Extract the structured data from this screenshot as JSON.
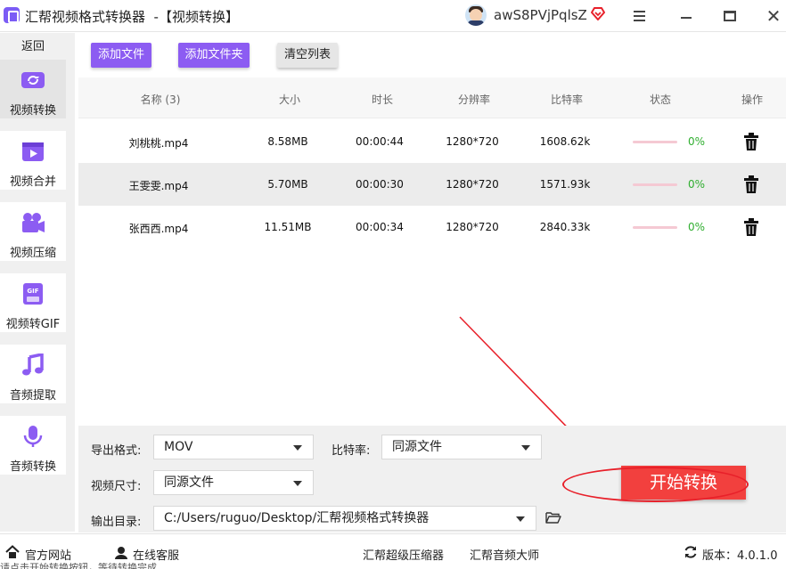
{
  "window": {
    "title": "汇帮视频格式转换器  -【视频转换】",
    "username": "awS8PVjPqlsZ",
    "colors": {
      "accent": "#8c5cf2",
      "start": "#f2403e",
      "progress_text": "#2fae2f"
    }
  },
  "sidebar": {
    "back_label": "返回",
    "items": [
      {
        "label": "视频转换",
        "icon": "video-convert-icon",
        "active": true
      },
      {
        "label": "视频合并",
        "icon": "video-merge-icon",
        "active": false
      },
      {
        "label": "视频压缩",
        "icon": "video-compress-icon",
        "active": false
      },
      {
        "label": "视频转GIF",
        "icon": "gif-icon",
        "active": false
      },
      {
        "label": "音频提取",
        "icon": "music-note-icon",
        "active": false
      },
      {
        "label": "音频转换",
        "icon": "microphone-icon",
        "active": false
      }
    ]
  },
  "toolbar": {
    "add_file": "添加文件",
    "add_folder": "添加文件夹",
    "clear_list": "清空列表"
  },
  "table": {
    "headers": [
      "名称 (3)",
      "大小",
      "时长",
      "分辨率",
      "比特率",
      "状态",
      "操作"
    ],
    "rows": [
      {
        "name": "刘桃桃.mp4",
        "size": "8.58MB",
        "duration": "00:00:44",
        "resolution": "1280*720",
        "bitrate": "1608.62k",
        "progress": "0%"
      },
      {
        "name": "王雯雯.mp4",
        "size": "5.70MB",
        "duration": "00:00:30",
        "resolution": "1280*720",
        "bitrate": "1571.93k",
        "progress": "0%"
      },
      {
        "name": "张西西.mp4",
        "size": "11.51MB",
        "duration": "00:00:34",
        "resolution": "1280*720",
        "bitrate": "2840.33k",
        "progress": "0%"
      }
    ]
  },
  "settings": {
    "format_label": "导出格式:",
    "format_value": "MOV",
    "bitrate_label": "比特率:",
    "bitrate_value": "同源文件",
    "size_label": "视频尺寸:",
    "size_value": "同源文件",
    "output_label": "输出目录:",
    "output_value": "C:/Users/ruguo/Desktop/汇帮视频格式转换器",
    "start_button": "开始转换"
  },
  "footer": {
    "website": "官方网站",
    "support": "在线客服",
    "compressor": "汇帮超级压缩器",
    "audio_master": "汇帮音频大师",
    "version": "版本：4.0.1.0",
    "status_text": "请点击开始转换按钮，等待转换完成"
  }
}
